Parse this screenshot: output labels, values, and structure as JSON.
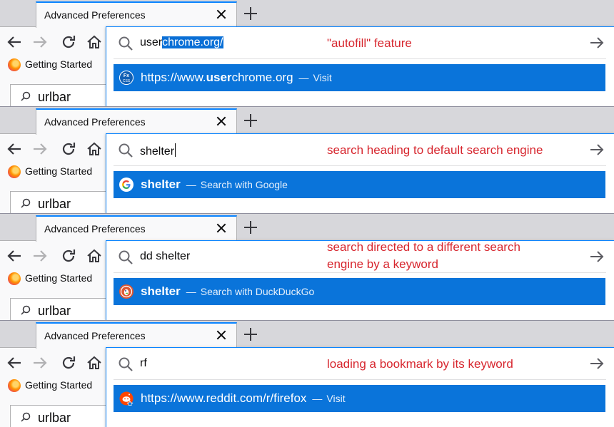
{
  "browser": {
    "tab_title": "Advanced Preferences",
    "bookmark_label": "Getting Started",
    "page_search_text": "urlbar"
  },
  "colors": {
    "accent": "#0a84ff",
    "result_highlight": "#0a74da",
    "annotation_red": "#d7262e"
  },
  "panels": [
    {
      "typed": "user",
      "autofilled": "chrome.org/",
      "annotation_lines": [
        "\"autofill\" feature"
      ],
      "result_icon": "fx-css-icon",
      "result_bold": "",
      "result_text_before": "https://www.",
      "result_text_bold": "user",
      "result_text_after": "chrome.org",
      "result_sep": "—",
      "result_action": "Visit"
    },
    {
      "typed": "shelter",
      "autofilled": "",
      "annotation_lines": [
        "search heading to default search engine"
      ],
      "result_icon": "google-icon",
      "result_text_before": "",
      "result_text_bold": "shelter",
      "result_text_after": "",
      "result_sep": "—",
      "result_action": "Search with Google"
    },
    {
      "typed": "dd shelter",
      "autofilled": "",
      "annotation_lines": [
        "search directed to a different search",
        "engine by a keyword"
      ],
      "result_icon": "duckduckgo-icon",
      "result_text_before": "",
      "result_text_bold": "shelter",
      "result_text_after": "",
      "result_sep": "—",
      "result_action": "Search with DuckDuckGo"
    },
    {
      "typed": "rf",
      "autofilled": "",
      "annotation_lines": [
        "loading a bookmark by its keyword"
      ],
      "result_icon": "reddit-bookmark-icon",
      "result_text_before": "https://www.reddit.com/r/firefox",
      "result_text_bold": "",
      "result_text_after": "",
      "result_sep": "—",
      "result_action": "Visit"
    }
  ]
}
